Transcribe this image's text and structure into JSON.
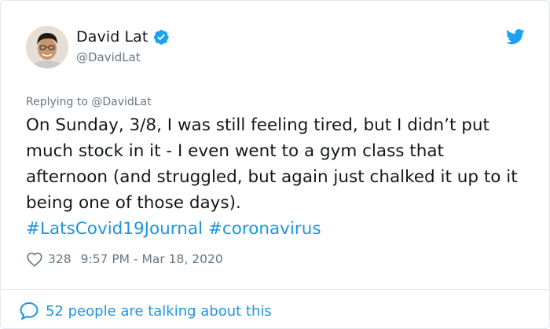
{
  "author": {
    "display_name": "David Lat",
    "handle": "@DavidLat",
    "verified": true
  },
  "reply": {
    "prefix": "Replying to",
    "mention": "@DavidLat"
  },
  "tweet": {
    "text": "On Sunday, 3/8, I was still feeling tired, but I didn’t put much stock in it - I even went to a gym class that afternoon (and struggled, but again just chalked it up to it being one of those days).",
    "hashtags": [
      "#LatsCovid19Journal",
      "#coronavirus"
    ]
  },
  "meta": {
    "like_count": "328",
    "timestamp": "9:57 PM - Mar 18, 2020"
  },
  "footer": {
    "talking_text": "52 people are talking about this"
  },
  "colors": {
    "link_blue": "#1b95e0",
    "muted_gray": "#657786",
    "text_black": "#14171a",
    "verified_blue": "#1da1f2"
  },
  "icons": [
    "verified-badge-icon",
    "twitter-bird-icon",
    "heart-icon",
    "speech-bubble-icon"
  ]
}
